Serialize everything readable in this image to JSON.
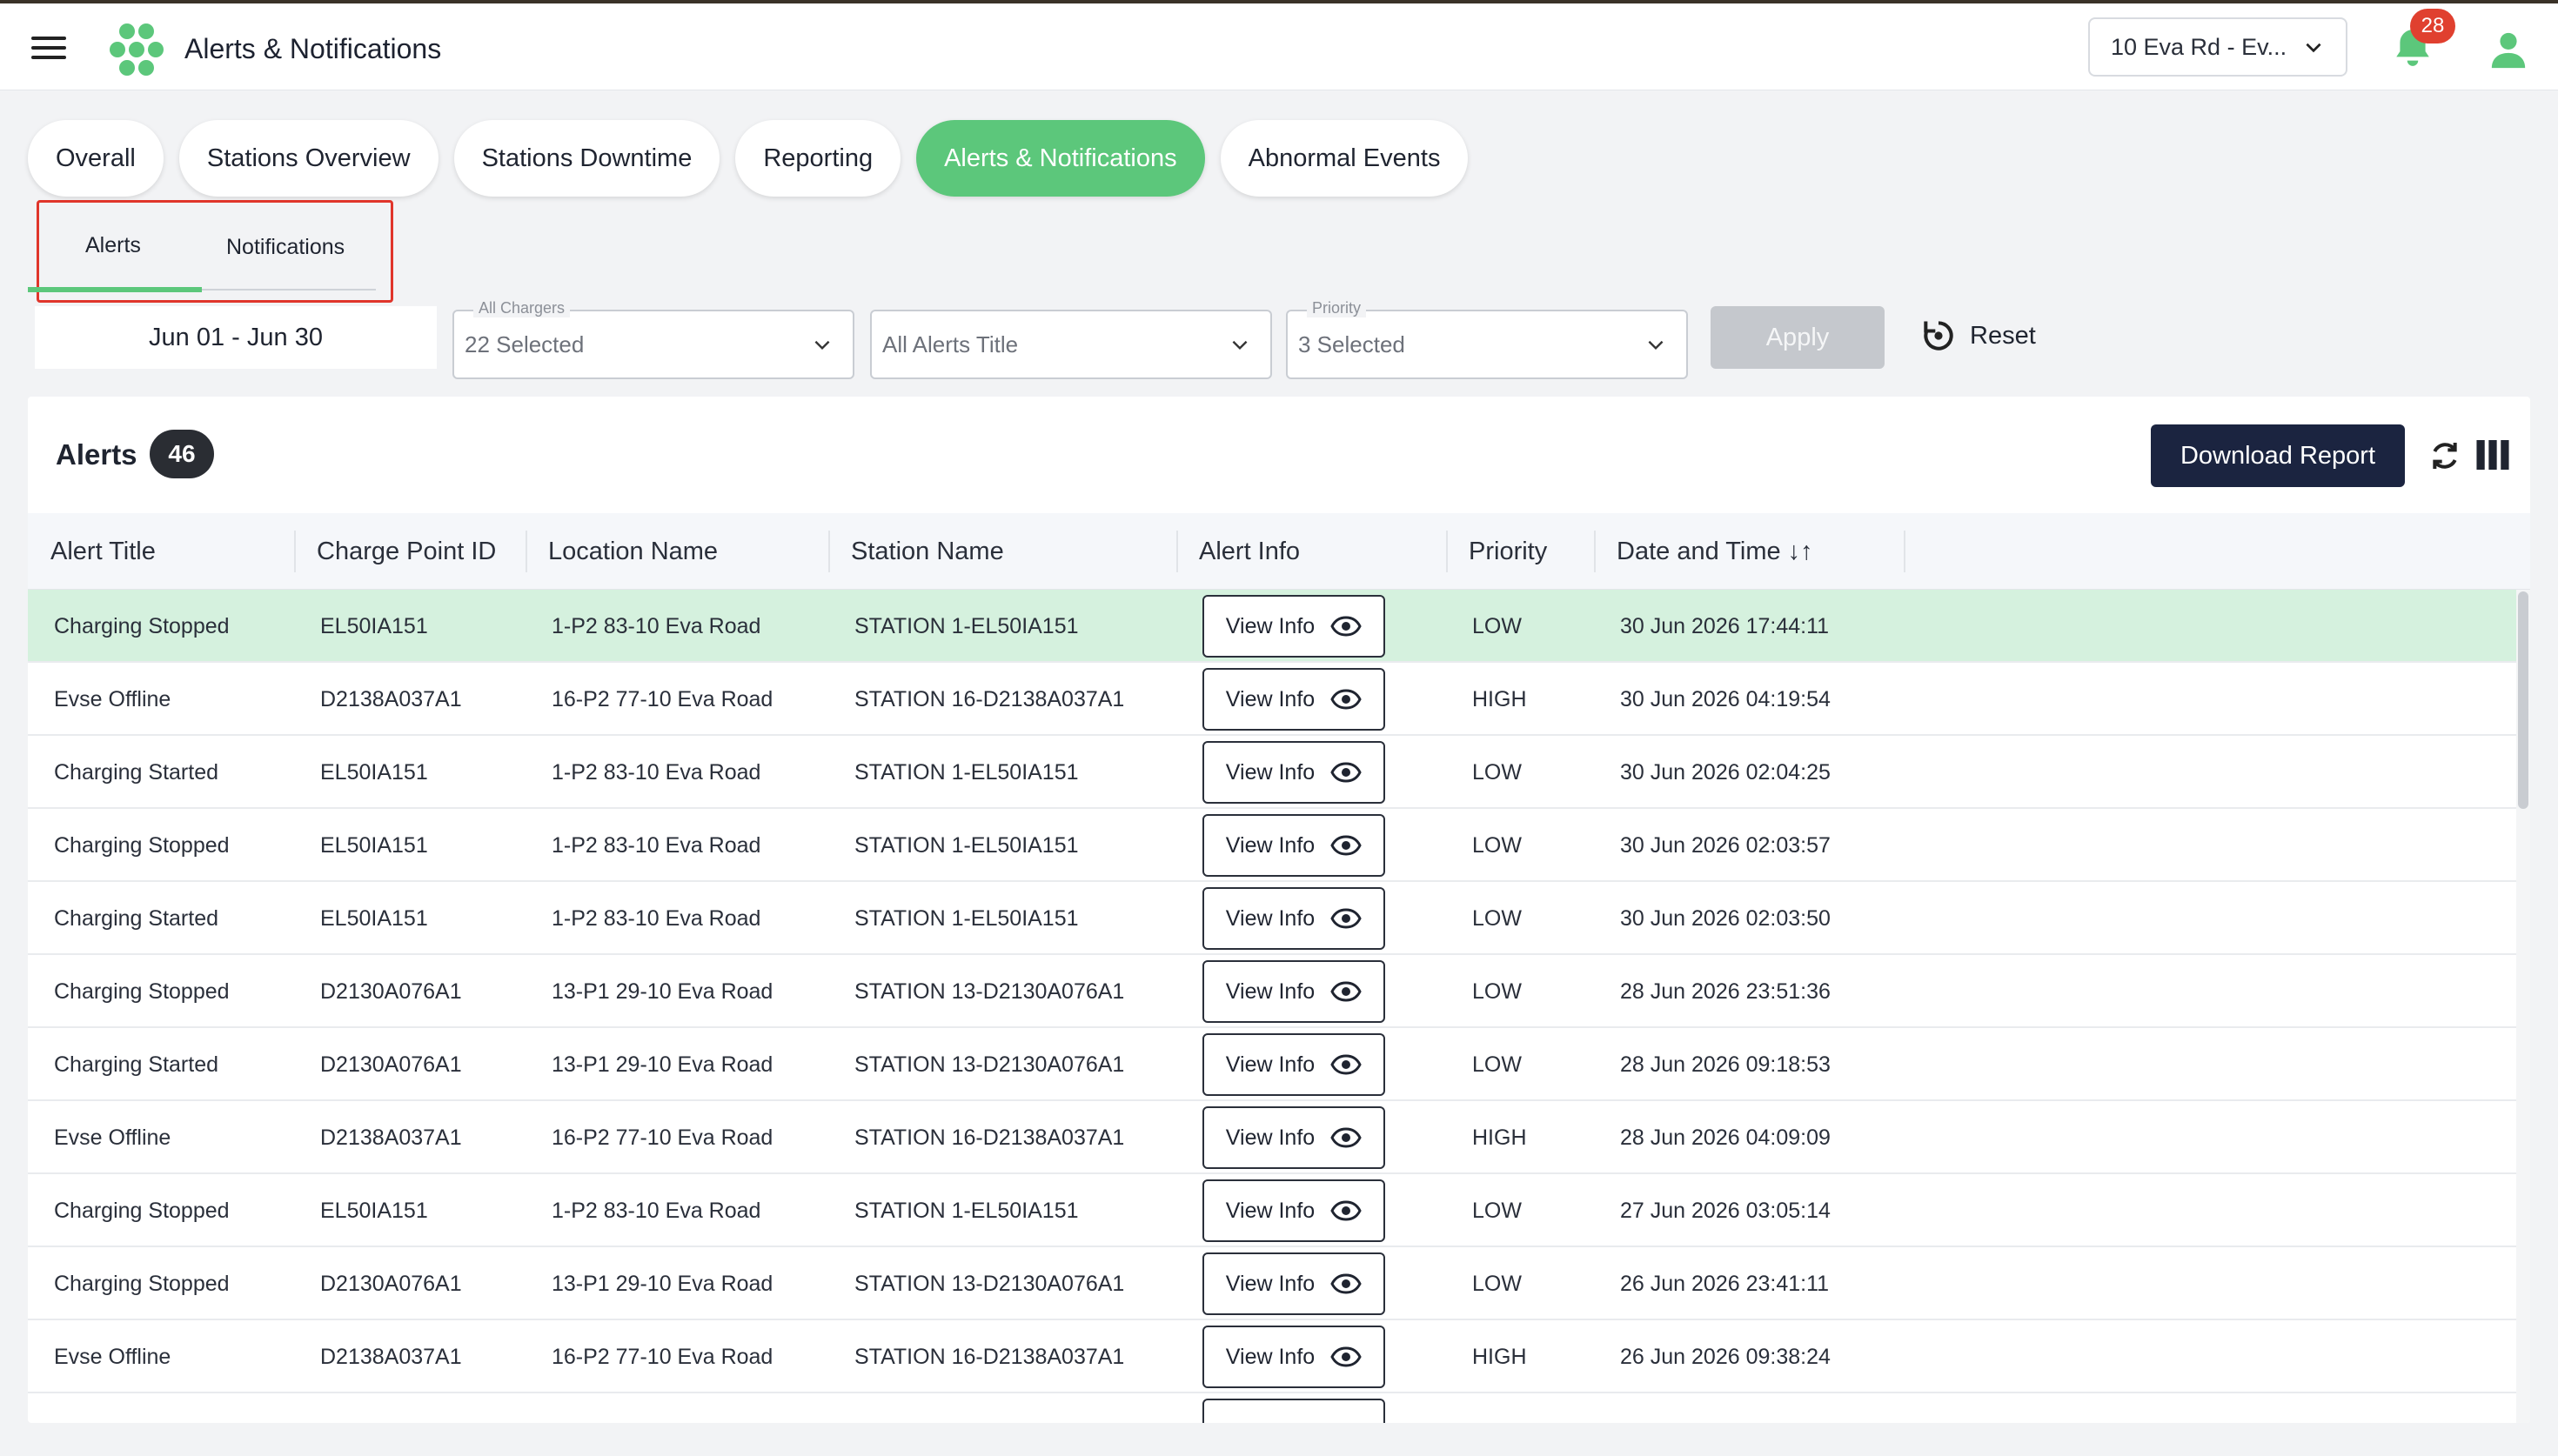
{
  "header": {
    "title": "Alerts & Notifications",
    "site_selector": "10 Eva Rd - Ev...",
    "notification_count": "28"
  },
  "tabs": [
    {
      "label": "Overall"
    },
    {
      "label": "Stations Overview"
    },
    {
      "label": "Stations Downtime"
    },
    {
      "label": "Reporting"
    },
    {
      "label": "Alerts & Notifications",
      "active": true
    },
    {
      "label": "Abnormal Events"
    }
  ],
  "subtabs": {
    "alerts": "Alerts",
    "notifications": "Notifications"
  },
  "filters": {
    "date_range": "Jun 01 - Jun 30",
    "chargers": {
      "label": "All Chargers",
      "value": "22 Selected"
    },
    "alert_title": {
      "value": "All Alerts Title"
    },
    "priority": {
      "label": "Priority",
      "value": "3 Selected"
    },
    "apply": "Apply",
    "reset": "Reset"
  },
  "alerts_card": {
    "title": "Alerts",
    "count": "46",
    "download": "Download Report"
  },
  "table": {
    "headers": [
      "Alert Title",
      "Charge Point ID",
      "Location Name",
      "Station Name",
      "Alert Info",
      "Priority",
      "Date and Time ↓↑"
    ],
    "view_label": "View Info",
    "rows": [
      {
        "title": "Charging Stopped",
        "cp": "EL50IA151",
        "location": "1-P2 83-10 Eva Road",
        "station": "STATION 1-EL50IA151",
        "priority": "LOW",
        "datetime": "30 Jun 2026 17:44:11"
      },
      {
        "title": "Evse Offline",
        "cp": "D2138A037A1",
        "location": "16-P2 77-10 Eva Road",
        "station": "STATION 16-D2138A037A1",
        "priority": "HIGH",
        "datetime": "30 Jun 2026 04:19:54"
      },
      {
        "title": "Charging Started",
        "cp": "EL50IA151",
        "location": "1-P2 83-10 Eva Road",
        "station": "STATION 1-EL50IA151",
        "priority": "LOW",
        "datetime": "30 Jun 2026 02:04:25"
      },
      {
        "title": "Charging Stopped",
        "cp": "EL50IA151",
        "location": "1-P2 83-10 Eva Road",
        "station": "STATION 1-EL50IA151",
        "priority": "LOW",
        "datetime": "30 Jun 2026 02:03:57"
      },
      {
        "title": "Charging Started",
        "cp": "EL50IA151",
        "location": "1-P2 83-10 Eva Road",
        "station": "STATION 1-EL50IA151",
        "priority": "LOW",
        "datetime": "30 Jun 2026 02:03:50"
      },
      {
        "title": "Charging Stopped",
        "cp": "D2130A076A1",
        "location": "13-P1 29-10 Eva Road",
        "station": "STATION 13-D2130A076A1",
        "priority": "LOW",
        "datetime": "28 Jun 2026 23:51:36"
      },
      {
        "title": "Charging Started",
        "cp": "D2130A076A1",
        "location": "13-P1 29-10 Eva Road",
        "station": "STATION 13-D2130A076A1",
        "priority": "LOW",
        "datetime": "28 Jun 2026 09:18:53"
      },
      {
        "title": "Evse Offline",
        "cp": "D2138A037A1",
        "location": "16-P2 77-10 Eva Road",
        "station": "STATION 16-D2138A037A1",
        "priority": "HIGH",
        "datetime": "28 Jun 2026 04:09:09"
      },
      {
        "title": "Charging Stopped",
        "cp": "EL50IA151",
        "location": "1-P2 83-10 Eva Road",
        "station": "STATION 1-EL50IA151",
        "priority": "LOW",
        "datetime": "27 Jun 2026 03:05:14"
      },
      {
        "title": "Charging Stopped",
        "cp": "D2130A076A1",
        "location": "13-P1 29-10 Eva Road",
        "station": "STATION 13-D2130A076A1",
        "priority": "LOW",
        "datetime": "26 Jun 2026 23:41:11"
      },
      {
        "title": "Evse Offline",
        "cp": "D2138A037A1",
        "location": "16-P2 77-10 Eva Road",
        "station": "STATION 16-D2138A037A1",
        "priority": "HIGH",
        "datetime": "26 Jun 2026 09:38:24"
      }
    ]
  },
  "colors": {
    "accent_green": "#5cc77b",
    "highlight_row": "#d5f1de",
    "primary_dark": "#1b2440",
    "badge_red": "#e0402f",
    "annotation_red": "#e0352b"
  },
  "icons": [
    "menu-icon",
    "logo-hex-icon",
    "chevron-down-icon",
    "bell-icon",
    "user-icon",
    "reset-icon",
    "refresh-icon",
    "columns-icon",
    "eye-icon"
  ]
}
